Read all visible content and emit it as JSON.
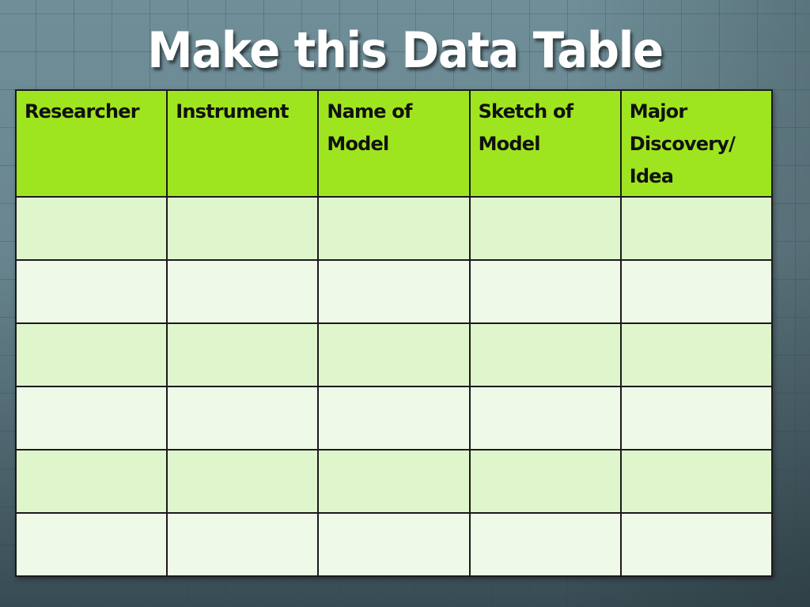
{
  "slide": {
    "title": "Make this Data Table"
  },
  "table": {
    "headers": [
      "Researcher",
      "Instrument",
      "Name of Model",
      "Sketch of Model",
      "Major Discovery/ Idea"
    ],
    "rows": [
      [
        "",
        "",
        "",
        "",
        ""
      ],
      [
        "",
        "",
        "",
        "",
        ""
      ],
      [
        "",
        "",
        "",
        "",
        ""
      ],
      [
        "",
        "",
        "",
        "",
        ""
      ],
      [
        "",
        "",
        "",
        "",
        ""
      ],
      [
        "",
        "",
        "",
        "",
        ""
      ]
    ]
  },
  "colors": {
    "header_bg": "#9fe51f",
    "row_odd_bg": "#dff6cd",
    "row_even_bg": "#eff9e8",
    "background": "#6f8e98",
    "title_color": "#ffffff"
  }
}
